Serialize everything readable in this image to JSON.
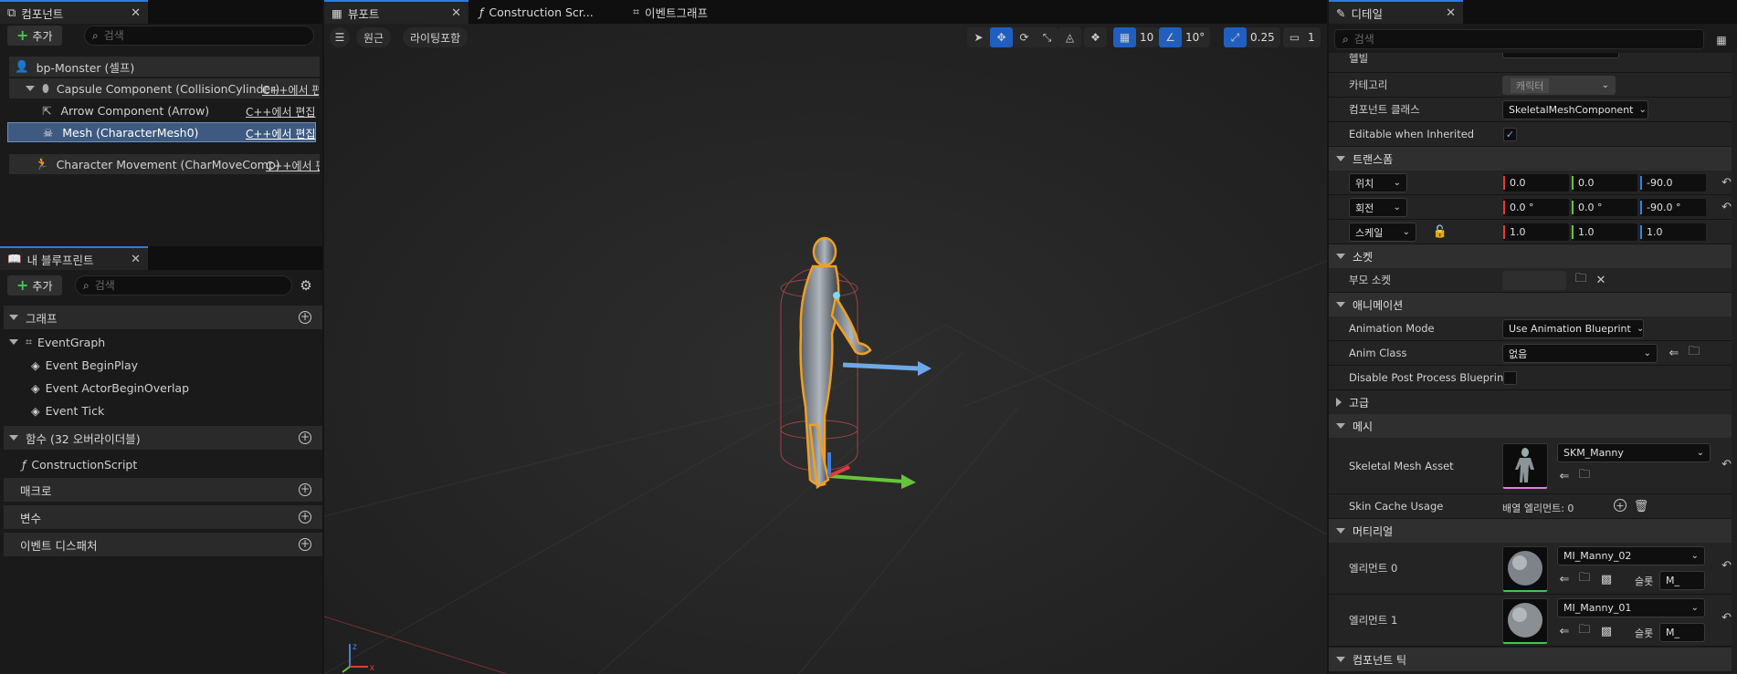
{
  "components_panel": {
    "tab_title": "컴포넌트",
    "add_label": "추가",
    "search_placeholder": "검색",
    "root": "bp-Monster (셀프)",
    "items": [
      {
        "label": "Capsule Component (CollisionCylinder)",
        "edit": "C++에서 편집"
      },
      {
        "label": "Arrow Component (Arrow)",
        "edit": "C++에서 편집"
      },
      {
        "label": "Mesh (CharacterMesh0)",
        "edit": "C++에서 편집"
      },
      {
        "label": "Character Movement (CharMoveComp)",
        "edit": "C++에서 편집"
      }
    ]
  },
  "blueprint_panel": {
    "tab_title": "내 블루프린트",
    "add_label": "추가",
    "search_placeholder": "검색",
    "graph_section": "그래프",
    "event_graph": "EventGraph",
    "events": [
      "Event BeginPlay",
      "Event ActorBeginOverlap",
      "Event Tick"
    ],
    "functions_section": "함수 (32 오버라이더블)",
    "construction_script": "ConstructionScript",
    "macros_section": "매크로",
    "variables_section": "변수",
    "dispatchers_section": "이벤트 디스패처"
  },
  "center_tabs": [
    "뷰포트",
    "Construction Scr...",
    "이벤트그래프"
  ],
  "viewport_toolbar": {
    "perspective": "원근",
    "lighting": "라이팅포함",
    "grid_snap": "10",
    "rotation_snap": "10°",
    "scale_snap": "0.25",
    "camera_speed": "1"
  },
  "details": {
    "tab_title": "디테일",
    "search_placeholder": "검색",
    "top_cut_label": "헬빌",
    "category_label": "카테고리",
    "category_value": "캐릭터",
    "component_class_label": "컴포넌트 클래스",
    "component_class_value": "SkeletalMeshComponent",
    "editable_label": "Editable when Inherited",
    "transform_section": "트랜스폼",
    "location_label": "위치",
    "location": [
      "0.0",
      "0.0",
      "-90.0"
    ],
    "rotation_label": "회전",
    "rotation": [
      "0.0 °",
      "0.0 °",
      "-90.0 °"
    ],
    "scale_label": "스케일",
    "scale": [
      "1.0",
      "1.0",
      "1.0"
    ],
    "sockets_section": "소켓",
    "parent_socket_label": "부모 소켓",
    "animation_section": "애니메이션",
    "anim_mode_label": "Animation Mode",
    "anim_mode_value": "Use Animation Blueprint",
    "anim_class_label": "Anim Class",
    "anim_class_value": "없음",
    "disable_pp_label": "Disable Post Process Blueprint",
    "advanced_section": "고급",
    "mesh_section": "메시",
    "skeletal_mesh_label": "Skeletal Mesh Asset",
    "skeletal_mesh_value": "SKM_Manny",
    "skin_cache_label": "Skin Cache Usage",
    "skin_cache_value": "배열 엘리먼트: 0",
    "materials_section": "머티리얼",
    "element0_label": "엘리먼트 0",
    "element0_value": "MI_Manny_02",
    "element1_label": "엘리먼트 1",
    "element1_value": "MI_Manny_01",
    "slot_label": "슬롯",
    "slot_value": "M_",
    "component_tick_section": "컴포넌트 틱"
  },
  "colors": {
    "accent": "#2d7be5",
    "x_axis": "#e03c3c",
    "y_axis": "#66c43a",
    "z_axis": "#3c7fe0"
  }
}
